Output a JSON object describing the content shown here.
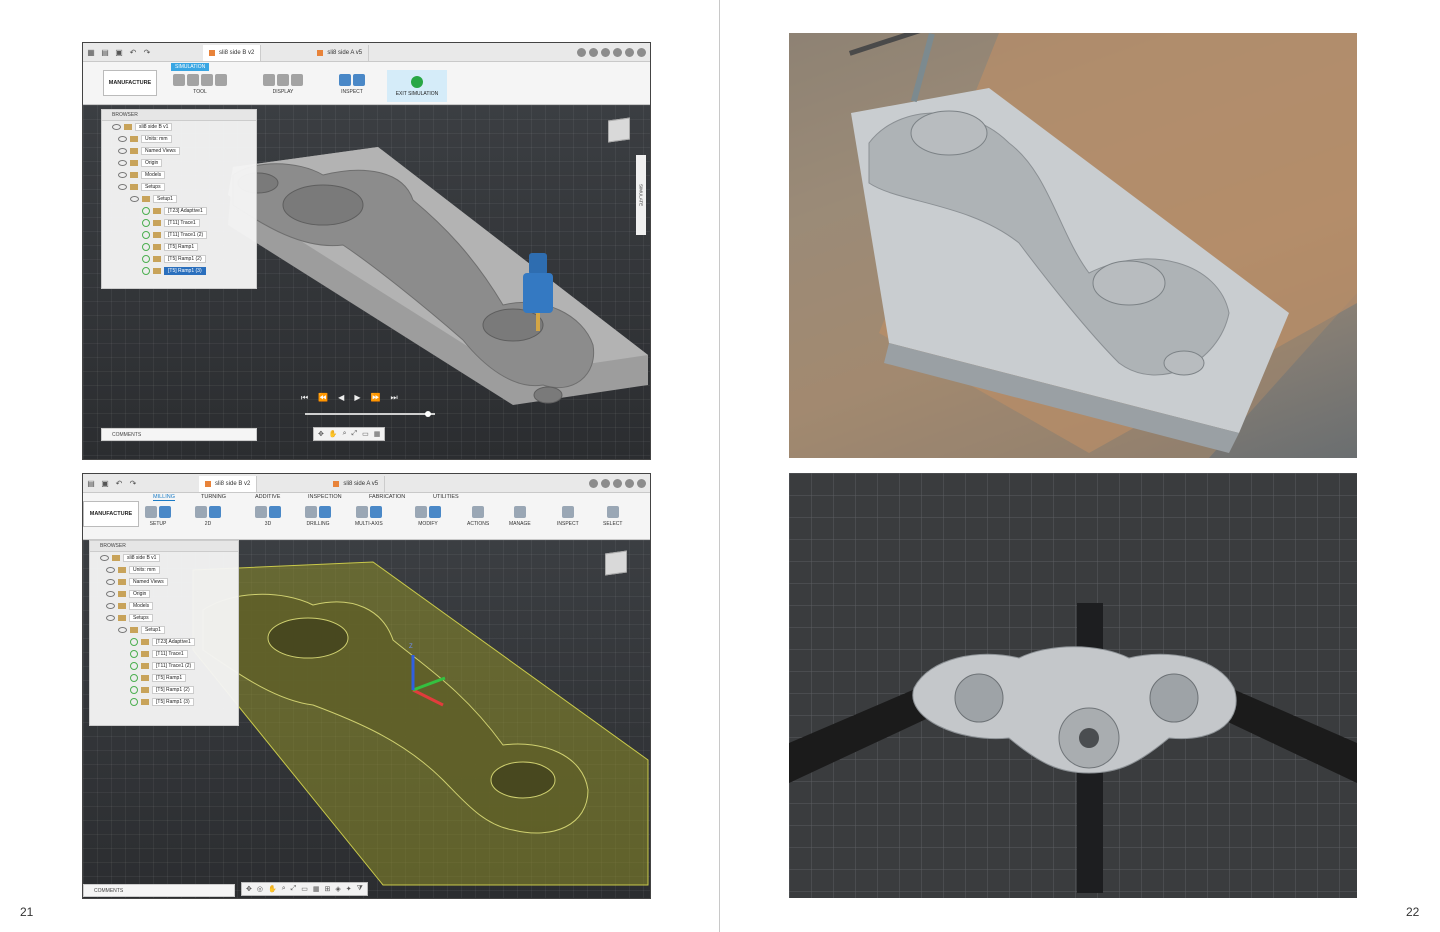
{
  "page_numbers": {
    "left": "21",
    "right": "22"
  },
  "colors": {
    "accent": "#1c7cc6",
    "simulation_tag": "#39a6e3",
    "exit_green": "#28a745",
    "selection": "#2a6fbd"
  },
  "top_screen": {
    "tabs": [
      {
        "label": "sli8 side B v2",
        "active": true
      },
      {
        "label": "sli8 side A v5",
        "active": false
      }
    ],
    "workspace_button": "MANUFACTURE",
    "workspace_tag": "SIMULATION",
    "ribbon_groups": [
      "TOOL",
      "DISPLAY",
      "INSPECT",
      "EXIT SIMULATION"
    ],
    "browser_title": "BROWSER",
    "tree": [
      {
        "label": "sli8 side B v1",
        "selected": false
      },
      {
        "label": "Units: mm",
        "selected": false
      },
      {
        "label": "Named Views",
        "selected": false
      },
      {
        "label": "Origin",
        "selected": false
      },
      {
        "label": "Models",
        "selected": false
      },
      {
        "label": "Setups",
        "selected": false
      },
      {
        "label": "Setup1",
        "selected": false
      },
      {
        "label": "[T23] Adaptive1",
        "selected": false
      },
      {
        "label": "[T11] Trace1",
        "selected": false
      },
      {
        "label": "[T11] Trace1 (2)",
        "selected": false
      },
      {
        "label": "[T5] Ramp1",
        "selected": false
      },
      {
        "label": "[T5] Ramp1 (2)",
        "selected": false
      },
      {
        "label": "[T5] Ramp1 (3)",
        "selected": true
      }
    ],
    "side_panel": "SIMULATE",
    "comments": "COMMENTS",
    "playback": [
      "⏮",
      "⏪",
      "◀",
      "▶",
      "⏩",
      "⏭"
    ]
  },
  "bottom_screen": {
    "tabs": [
      {
        "label": "sli8 side B v2",
        "active": true
      },
      {
        "label": "sli8 side A v5",
        "active": false
      }
    ],
    "workspace_button": "MANUFACTURE",
    "workspace_tabs": [
      "MILLING",
      "TURNING",
      "ADDITIVE",
      "INSPECTION",
      "FABRICATION",
      "UTILITIES"
    ],
    "ribbon_groups": [
      "SETUP",
      "2D",
      "3D",
      "DRILLING",
      "MULTI-AXIS",
      "MODIFY",
      "ACTIONS",
      "MANAGE",
      "INSPECT",
      "SELECT"
    ],
    "browser_title": "BROWSER",
    "tree": [
      {
        "label": "sli8 side B v1"
      },
      {
        "label": "Units: mm"
      },
      {
        "label": "Named Views"
      },
      {
        "label": "Origin"
      },
      {
        "label": "Models"
      },
      {
        "label": "Setups"
      },
      {
        "label": "Setup1"
      },
      {
        "label": "[T23] Adaptive1"
      },
      {
        "label": "[T11] Trace1"
      },
      {
        "label": "[T11] Trace1 (2)"
      },
      {
        "label": "[T5] Ramp1"
      },
      {
        "label": "[T5] Ramp1 (2)"
      },
      {
        "label": "[T5] Ramp1 (3)"
      }
    ],
    "axis_label": "Z",
    "comments": "COMMENTS"
  }
}
